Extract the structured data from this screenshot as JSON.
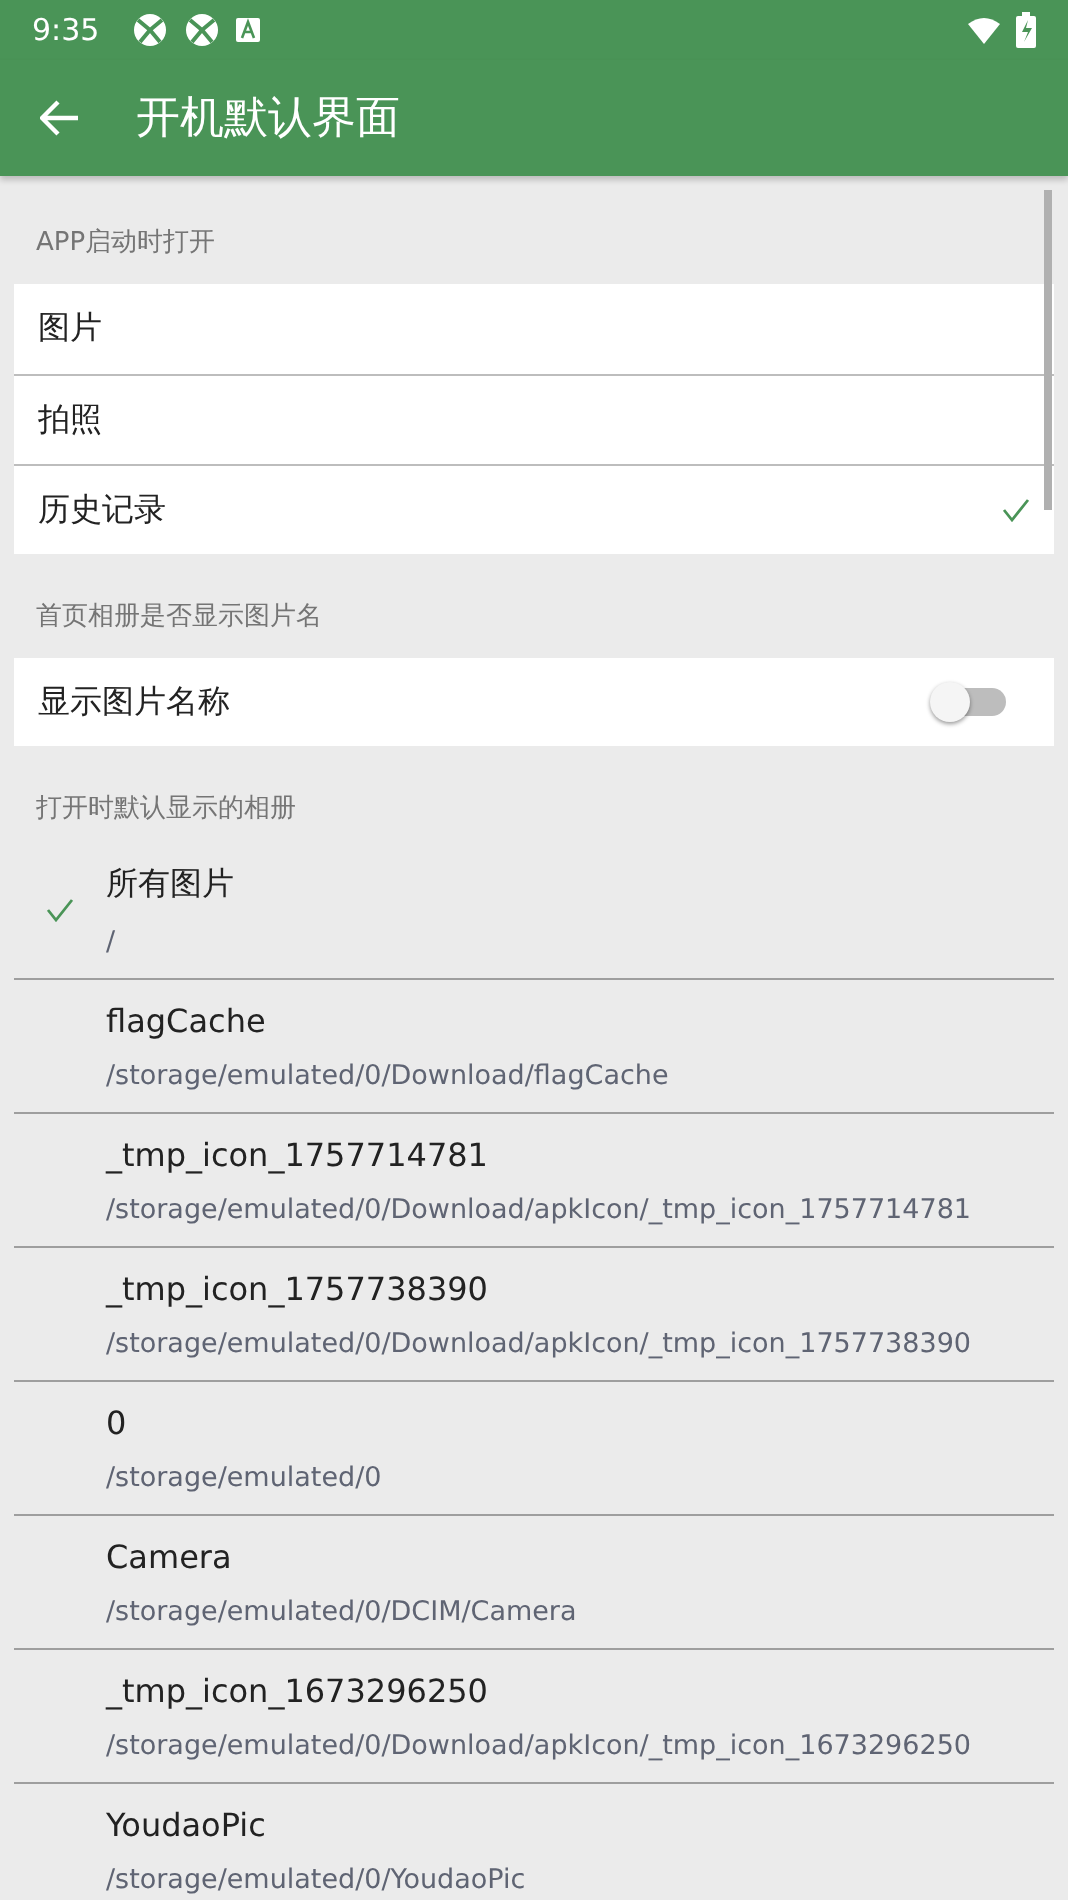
{
  "status_bar": {
    "time": "9:35"
  },
  "app_bar": {
    "title": "开机默认界面"
  },
  "startup": {
    "header": "APP启动时打开",
    "options": [
      {
        "label": "图片",
        "selected": false
      },
      {
        "label": "拍照",
        "selected": false
      },
      {
        "label": "历史记录",
        "selected": true
      }
    ]
  },
  "album_name": {
    "header": "首页相册是否显示图片名",
    "label": "显示图片名称",
    "on": false
  },
  "albums": {
    "header": "打开时默认显示的相册",
    "items": [
      {
        "name": "所有图片",
        "path": "/",
        "selected": true
      },
      {
        "name": "flagCache",
        "path": "/storage/emulated/0/Download/flagCache",
        "selected": false
      },
      {
        "name": "_tmp_icon_1757714781",
        "path": "/storage/emulated/0/Download/apkIcon/_tmp_icon_1757714781",
        "selected": false
      },
      {
        "name": "_tmp_icon_1757738390",
        "path": "/storage/emulated/0/Download/apkIcon/_tmp_icon_1757738390",
        "selected": false
      },
      {
        "name": "0",
        "path": "/storage/emulated/0",
        "selected": false
      },
      {
        "name": "Camera",
        "path": "/storage/emulated/0/DCIM/Camera",
        "selected": false
      },
      {
        "name": "_tmp_icon_1673296250",
        "path": "/storage/emulated/0/Download/apkIcon/_tmp_icon_1673296250",
        "selected": false
      },
      {
        "name": "YoudaoPic",
        "path": "/storage/emulated/0/YoudaoPic",
        "selected": false
      }
    ]
  }
}
